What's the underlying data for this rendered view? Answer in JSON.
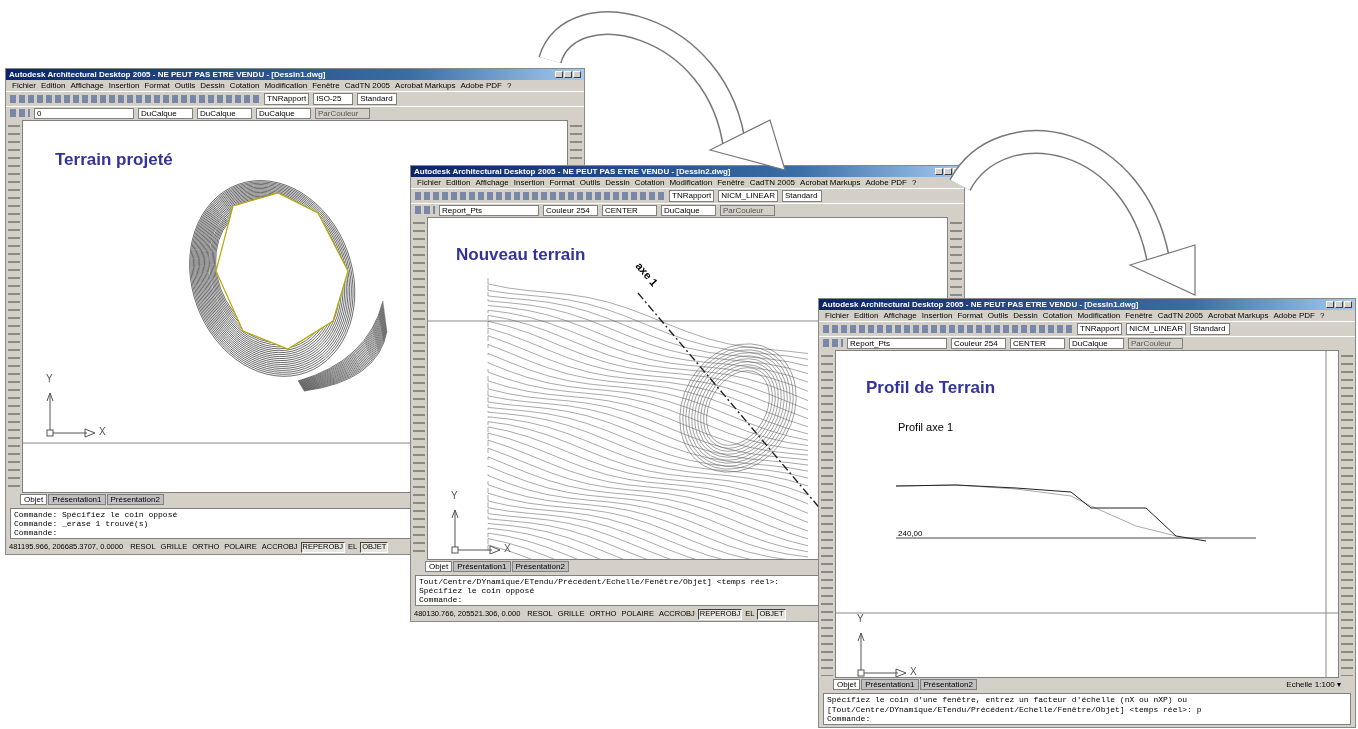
{
  "windows": [
    {
      "kind": "plan",
      "title": "Autodesk Architectural Desktop 2005 - NE PEUT PAS ETRE VENDU - [Dessin1.dwg]",
      "menu": [
        "Fichier",
        "Edition",
        "Affichage",
        "Insertion",
        "Format",
        "Outils",
        "Dessin",
        "Cotation",
        "Modification",
        "Fenêtre",
        "CadTN 2005",
        "Acrobat Markups",
        "Adobe PDF",
        "?"
      ],
      "styles": [
        "TNRapport",
        "ISO-25",
        "Standard"
      ],
      "layers": [
        "0",
        "DuCalque",
        "DuCalque",
        "DuCalque",
        "ParCouleur"
      ],
      "heading": "Terrain projeté",
      "ucs": [
        "Y",
        "X"
      ],
      "tabs": [
        {
          "label": "Objet",
          "selected": true
        },
        {
          "label": "Présentation1",
          "selected": false
        },
        {
          "label": "Présentation2",
          "selected": false
        }
      ],
      "command_lines": [
        "Commande:  Spécifiez le coin opposé",
        "Commande:  _erase 1 trouvé(s)",
        "Commande:"
      ],
      "coords": "481195.966, 206685.3707, 0.0000",
      "toggles": [
        {
          "label": "RESOL",
          "on": false
        },
        {
          "label": "GRILLE",
          "on": false
        },
        {
          "label": "ORTHO",
          "on": false
        },
        {
          "label": "POLAIRE",
          "on": false
        },
        {
          "label": "ACCROBJ",
          "on": false
        },
        {
          "label": "REPEROBJ",
          "on": true
        },
        {
          "label": "EL",
          "on": false
        },
        {
          "label": "OBJET",
          "on": true
        }
      ]
    },
    {
      "kind": "terrain",
      "title": "Autodesk Architectural Desktop 2005 - NE PEUT PAS ETRE VENDU - [Dessin2.dwg]",
      "menu": [
        "Fichier",
        "Edition",
        "Affichage",
        "Insertion",
        "Format",
        "Outils",
        "Dessin",
        "Cotation",
        "Modification",
        "Fenêtre",
        "CadTN 2005",
        "Acrobat Markups",
        "Adobe PDF",
        "?"
      ],
      "styles": [
        "TNRapport",
        "NICM_LINEAR",
        "Standard"
      ],
      "layers": [
        "Report_Pts",
        "Couleur 254",
        "CENTER",
        "DuCalque",
        "ParCouleur"
      ],
      "heading": "Nouveau terrain",
      "axis_label": "axe 1",
      "ucs": [
        "Y",
        "X"
      ],
      "tabs": [
        {
          "label": "Objet",
          "selected": true
        },
        {
          "label": "Présentation1",
          "selected": false
        },
        {
          "label": "Présentation2",
          "selected": false
        }
      ],
      "command_lines": [
        "Tout/Centre/DYnamique/ETendu/Précédent/Echelle/Fenêtre/Objet] <temps réel>:",
        "Spécifiez le coin opposé",
        "Commande:"
      ],
      "coords": "480130.766, 205521.306, 0.000",
      "toggles": [
        {
          "label": "RESOL",
          "on": false
        },
        {
          "label": "GRILLE",
          "on": false
        },
        {
          "label": "ORTHO",
          "on": false
        },
        {
          "label": "POLAIRE",
          "on": false
        },
        {
          "label": "ACCROBJ",
          "on": false
        },
        {
          "label": "REPEROBJ",
          "on": true
        },
        {
          "label": "EL",
          "on": false
        },
        {
          "label": "OBJET",
          "on": true
        }
      ]
    },
    {
      "kind": "profile",
      "title": "Autodesk Architectural Desktop 2005 - NE PEUT PAS ETRE VENDU - [Dessin1.dwg]",
      "menu": [
        "Fichier",
        "Edition",
        "Affichage",
        "Insertion",
        "Format",
        "Outils",
        "Dessin",
        "Cotation",
        "Modification",
        "Fenêtre",
        "CadTN 2005",
        "Acrobat Markups",
        "Adobe PDF",
        "?"
      ],
      "styles": [
        "TNRapport",
        "NICM_LINEAR",
        "Standard"
      ],
      "layers": [
        "Report_Pts",
        "Couleur 254",
        "CENTER",
        "DuCalque",
        "ParCouleur"
      ],
      "heading": "Profil de Terrain",
      "profile_title": "Profil axe 1",
      "datum": "240,00",
      "ucs": [
        "Y",
        "X"
      ],
      "tabs": [
        {
          "label": "Objet",
          "selected": true
        },
        {
          "label": "Présentation1",
          "selected": false
        },
        {
          "label": "Présentation2",
          "selected": false
        }
      ],
      "scale": "Echelle  1:100 ▾",
      "command_lines": [
        "Spécifiez le coin d'une fenêtre, entrez un facteur d'échelle (nX ou nXP) ou",
        "[Tout/Centre/DYnamique/ETendu/Précédent/Echelle/Fenêtre/Objet] <temps réel>:  p",
        "Commande:"
      ]
    }
  ]
}
